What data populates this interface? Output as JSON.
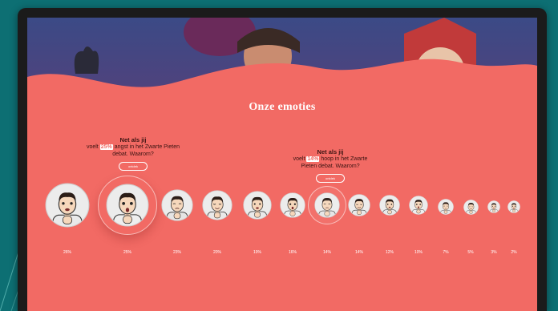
{
  "page": {
    "section_title": "Onze emoties",
    "colors": {
      "background": "#f26a64",
      "outer": "#0d6f73",
      "text_dark": "#3b1412",
      "highlight": "#ffffff"
    }
  },
  "callout_left": {
    "name": "Net als jij",
    "pre": "voelt",
    "percent": "25%",
    "post": "angst in het Zwarte Pieten debat. Waarom?",
    "button": "ontdek"
  },
  "callout_right": {
    "name": "Net als jij",
    "pre": "voelt",
    "percent": "14%",
    "post": "hoop in het Zwarte Pieten debat. Waarom?",
    "button": "ontdek"
  },
  "emotions": [
    {
      "percent": "26%",
      "icon": "scared-face-icon"
    },
    {
      "percent": "25%",
      "icon": "anxious-face-icon"
    },
    {
      "percent": "23%",
      "icon": "pensive-face-icon"
    },
    {
      "percent": "20%",
      "icon": "content-face-icon"
    },
    {
      "percent": "19%",
      "icon": "sad-face-icon"
    },
    {
      "percent": "16%",
      "icon": "unsure-face-icon"
    },
    {
      "percent": "14%",
      "icon": "hopeful-face-icon"
    },
    {
      "percent": "14%",
      "icon": "calm-face-icon"
    },
    {
      "percent": "12%",
      "icon": "smiling-face-icon"
    },
    {
      "percent": "10%",
      "icon": "thinking-face-icon"
    },
    {
      "percent": "7%",
      "icon": "shy-face-icon"
    },
    {
      "percent": "5%",
      "icon": "neutral-face-icon"
    },
    {
      "percent": "3%",
      "icon": "tired-face-icon"
    },
    {
      "percent": "2%",
      "icon": "relieved-face-icon"
    }
  ]
}
